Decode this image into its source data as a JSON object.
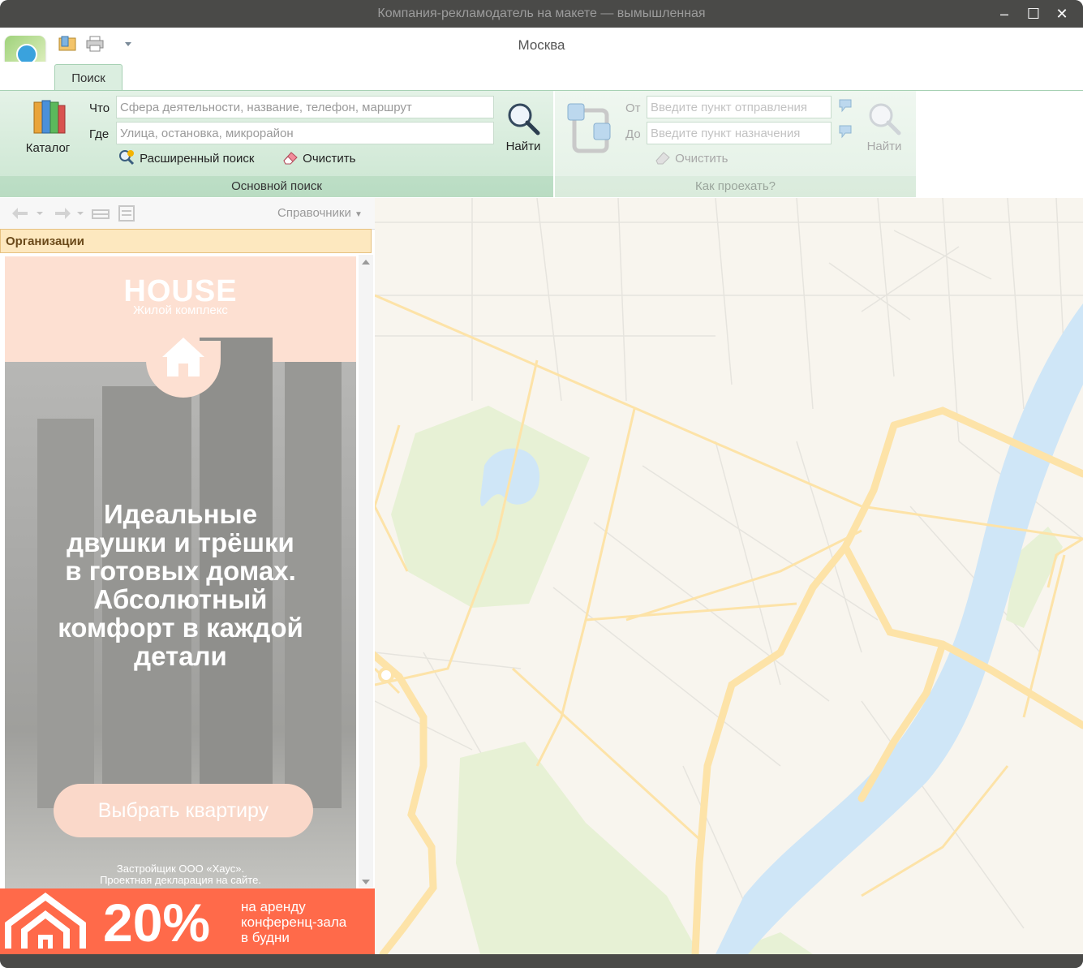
{
  "window": {
    "title": "Компания-рекламодатель на макете — вымышленная",
    "minimize_glyph": "–",
    "maximize_glyph": "☐",
    "close_glyph": "✕"
  },
  "header": {
    "city": "Москва",
    "quick_access_icons": [
      "layout-icon",
      "print-icon",
      "customize-arrow-icon"
    ]
  },
  "ribbon": {
    "tabs": [
      {
        "label": "Поиск",
        "active": true
      }
    ],
    "main_search": {
      "group_label": "Основной поиск",
      "catalog_label": "Каталог",
      "what_label": "Что",
      "what_placeholder": "Сфера деятельности, название, телефон, маршрут",
      "where_label": "Где",
      "where_placeholder": "Улица, остановка, микрорайон",
      "find_label": "Найти",
      "advanced_label": "Расширенный поиск",
      "clear_label": "Очистить"
    },
    "route": {
      "group_label": "Как проехать?",
      "from_label": "От",
      "from_placeholder": "Введите пункт отправления",
      "to_label": "До",
      "to_placeholder": "Введите пункт назначения",
      "clear_label": "Очистить",
      "find_label": "Найти"
    }
  },
  "left_panel": {
    "references_label": "Справочники",
    "section_header": "Организации",
    "ad": {
      "brand": "HOUSE",
      "subtitle": "Жилой комплекс",
      "headline_lines": [
        "Идеальные",
        "двушки и трёшки",
        "в готовых домах.",
        "Абсолютный",
        "комфорт в каждой",
        "детали"
      ],
      "button": "Выбрать квартиру",
      "footer_lines": [
        "Застройщик ООО «Хаус».",
        "Проектная декларация на сайте."
      ]
    },
    "promo": {
      "percent": "20%",
      "lines": [
        "на аренду",
        "конференц-зала",
        "в будни"
      ]
    }
  },
  "colors": {
    "titlebar": "#4a4a48",
    "ribbon_green": "#cbe6d1",
    "ad_peach": "#fde0d2",
    "promo_orange": "#ff6a4a",
    "map_road": "#fde3a8",
    "map_water": "#cfe6f7",
    "map_park": "#e7f1d5"
  }
}
